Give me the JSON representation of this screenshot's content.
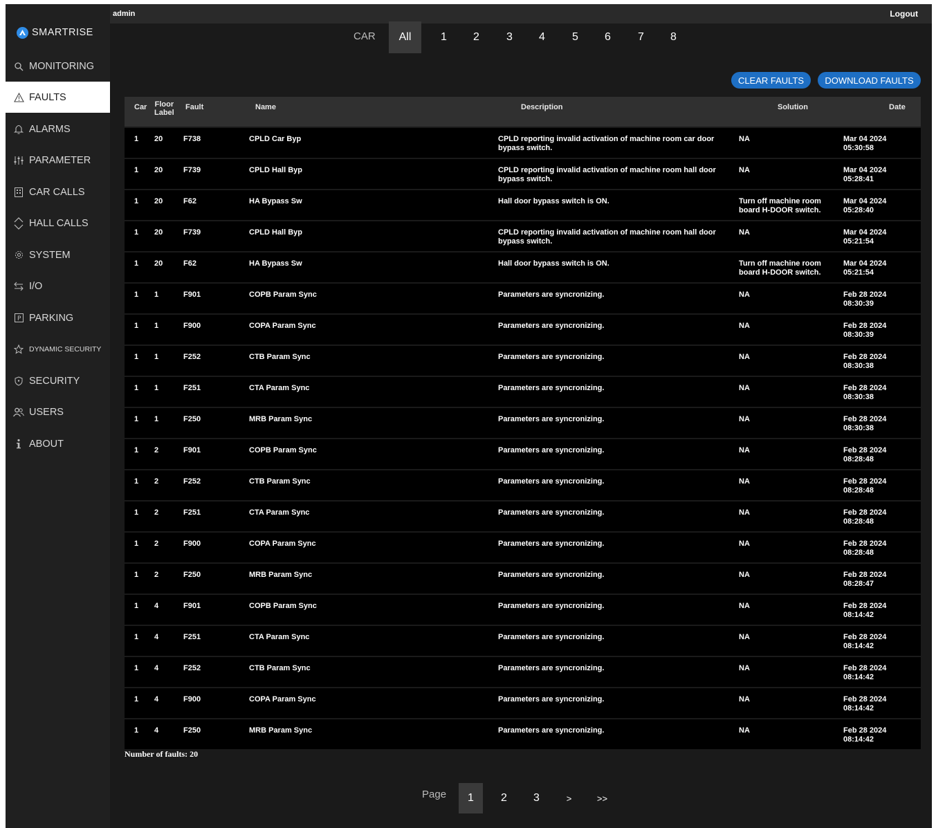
{
  "header": {
    "user": "admin",
    "logout_label": "Logout"
  },
  "brand": {
    "name": "SMARTRISE"
  },
  "nav": [
    {
      "label": "MONITORING",
      "icon": "search-icon"
    },
    {
      "label": "FAULTS",
      "icon": "warning-icon"
    },
    {
      "label": "ALARMS",
      "icon": "bell-icon"
    },
    {
      "label": "PARAMETER",
      "icon": "sliders-icon"
    },
    {
      "label": "CAR CALLS",
      "icon": "keypad-icon"
    },
    {
      "label": "HALL CALLS",
      "icon": "up-down-icon"
    },
    {
      "label": "SYSTEM",
      "icon": "gear-icon"
    },
    {
      "label": "I/O",
      "icon": "arrows-icon"
    },
    {
      "label": "PARKING",
      "icon": "parking-icon"
    },
    {
      "label": "DYNAMIC SECURITY",
      "icon": "star-icon"
    },
    {
      "label": "SECURITY",
      "icon": "shield-icon"
    },
    {
      "label": "USERS",
      "icon": "users-icon"
    },
    {
      "label": "ABOUT",
      "icon": "info-icon"
    }
  ],
  "active_nav": "FAULTS",
  "car_tabs": {
    "label": "CAR",
    "tabs": [
      "All",
      "1",
      "2",
      "3",
      "4",
      "5",
      "6",
      "7",
      "8"
    ],
    "selected": "All"
  },
  "actions": {
    "clear": "CLEAR FAULTS",
    "download": "DOWNLOAD FAULTS"
  },
  "table": {
    "headers": {
      "car": "Car",
      "floor_1": "Floor",
      "floor_2": "Label",
      "fault": "Fault",
      "name": "Name",
      "description": "Description",
      "solution": "Solution",
      "date": "Date"
    },
    "rows": [
      {
        "car": "1",
        "floor": "20",
        "fault": "F738",
        "name": "CPLD Car Byp",
        "description": "CPLD reporting invalid activation of machine room car door bypass switch.",
        "solution": "NA",
        "date": "Mar 04 2024",
        "time": "05:30:58"
      },
      {
        "car": "1",
        "floor": "20",
        "fault": "F739",
        "name": "CPLD Hall Byp",
        "description": "CPLD reporting invalid activation of machine room hall door bypass switch.",
        "solution": "NA",
        "date": "Mar 04 2024",
        "time": "05:28:41"
      },
      {
        "car": "1",
        "floor": "20",
        "fault": "F62",
        "name": "HA Bypass Sw",
        "description": "Hall door bypass switch is ON.",
        "solution": "Turn off machine room board H-DOOR switch.",
        "date": "Mar 04 2024",
        "time": "05:28:40"
      },
      {
        "car": "1",
        "floor": "20",
        "fault": "F739",
        "name": "CPLD Hall Byp",
        "description": "CPLD reporting invalid activation of machine room hall door bypass switch.",
        "solution": "NA",
        "date": "Mar 04 2024",
        "time": "05:21:54"
      },
      {
        "car": "1",
        "floor": "20",
        "fault": "F62",
        "name": "HA Bypass Sw",
        "description": "Hall door bypass switch is ON.",
        "solution": "Turn off machine room board H-DOOR switch.",
        "date": "Mar 04 2024",
        "time": "05:21:54"
      },
      {
        "car": "1",
        "floor": "1",
        "fault": "F901",
        "name": "COPB Param Sync",
        "description": "Parameters are syncronizing.",
        "solution": "NA",
        "date": "Feb 28 2024",
        "time": "08:30:39"
      },
      {
        "car": "1",
        "floor": "1",
        "fault": "F900",
        "name": "COPA Param Sync",
        "description": "Parameters are syncronizing.",
        "solution": "NA",
        "date": "Feb 28 2024",
        "time": "08:30:39"
      },
      {
        "car": "1",
        "floor": "1",
        "fault": "F252",
        "name": "CTB Param Sync",
        "description": "Parameters are syncronizing.",
        "solution": "NA",
        "date": "Feb 28 2024",
        "time": "08:30:38"
      },
      {
        "car": "1",
        "floor": "1",
        "fault": "F251",
        "name": "CTA Param Sync",
        "description": "Parameters are syncronizing.",
        "solution": "NA",
        "date": "Feb 28 2024",
        "time": "08:30:38"
      },
      {
        "car": "1",
        "floor": "1",
        "fault": "F250",
        "name": "MRB Param Sync",
        "description": "Parameters are syncronizing.",
        "solution": "NA",
        "date": "Feb 28 2024",
        "time": "08:30:38"
      },
      {
        "car": "1",
        "floor": "2",
        "fault": "F901",
        "name": "COPB Param Sync",
        "description": "Parameters are syncronizing.",
        "solution": "NA",
        "date": "Feb 28 2024",
        "time": "08:28:48"
      },
      {
        "car": "1",
        "floor": "2",
        "fault": "F252",
        "name": "CTB Param Sync",
        "description": "Parameters are syncronizing.",
        "solution": "NA",
        "date": "Feb 28 2024",
        "time": "08:28:48"
      },
      {
        "car": "1",
        "floor": "2",
        "fault": "F251",
        "name": "CTA Param Sync",
        "description": "Parameters are syncronizing.",
        "solution": "NA",
        "date": "Feb 28 2024",
        "time": "08:28:48"
      },
      {
        "car": "1",
        "floor": "2",
        "fault": "F900",
        "name": "COPA Param Sync",
        "description": "Parameters are syncronizing.",
        "solution": "NA",
        "date": "Feb 28 2024",
        "time": "08:28:48"
      },
      {
        "car": "1",
        "floor": "2",
        "fault": "F250",
        "name": "MRB Param Sync",
        "description": "Parameters are syncronizing.",
        "solution": "NA",
        "date": "Feb 28 2024",
        "time": "08:28:47"
      },
      {
        "car": "1",
        "floor": "4",
        "fault": "F901",
        "name": "COPB Param Sync",
        "description": "Parameters are syncronizing.",
        "solution": "NA",
        "date": "Feb 28 2024",
        "time": "08:14:42"
      },
      {
        "car": "1",
        "floor": "4",
        "fault": "F251",
        "name": "CTA Param Sync",
        "description": "Parameters are syncronizing.",
        "solution": "NA",
        "date": "Feb 28 2024",
        "time": "08:14:42"
      },
      {
        "car": "1",
        "floor": "4",
        "fault": "F252",
        "name": "CTB Param Sync",
        "description": "Parameters are syncronizing.",
        "solution": "NA",
        "date": "Feb 28 2024",
        "time": "08:14:42"
      },
      {
        "car": "1",
        "floor": "4",
        "fault": "F900",
        "name": "COPA Param Sync",
        "description": "Parameters are syncronizing.",
        "solution": "NA",
        "date": "Feb 28 2024",
        "time": "08:14:42"
      },
      {
        "car": "1",
        "floor": "4",
        "fault": "F250",
        "name": "MRB Param Sync",
        "description": "Parameters are syncronizing.",
        "solution": "NA",
        "date": "Feb 28 2024",
        "time": "08:14:42"
      }
    ]
  },
  "summary": {
    "count_label": "Number of faults: 20"
  },
  "pagination": {
    "label": "Page",
    "pages": [
      "1",
      "2",
      "3"
    ],
    "next": ">",
    "last": ">>",
    "current": "1"
  },
  "colors": {
    "accent": "#1e6fc4",
    "sidebar": "#202020",
    "background": "#1a1a1a"
  }
}
